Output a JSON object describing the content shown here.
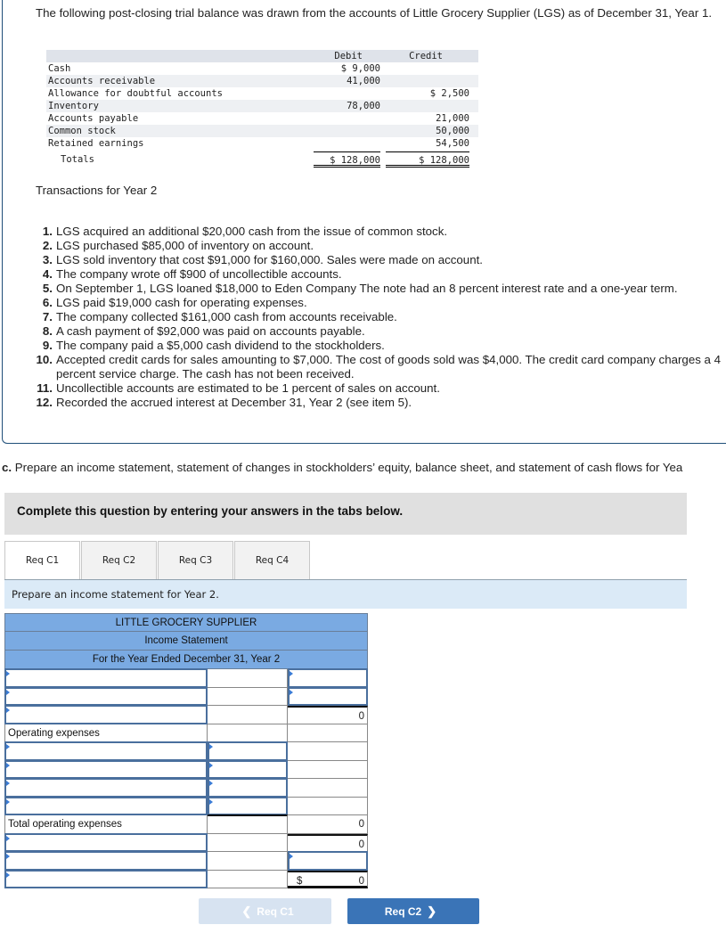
{
  "intro": "The following post-closing trial balance was drawn from the accounts of Little Grocery Supplier (LGS) as of December 31, Year 1.",
  "trial_balance": {
    "headers": {
      "debit": "Debit",
      "credit": "Credit"
    },
    "rows": [
      {
        "account": "Cash",
        "debit": "$ 9,000",
        "credit": ""
      },
      {
        "account": "Accounts receivable",
        "debit": "41,000",
        "credit": ""
      },
      {
        "account": "Allowance for doubtful accounts",
        "debit": "",
        "credit": "$ 2,500"
      },
      {
        "account": "Inventory",
        "debit": "78,000",
        "credit": ""
      },
      {
        "account": "Accounts payable",
        "debit": "",
        "credit": "21,000"
      },
      {
        "account": "Common stock",
        "debit": "",
        "credit": "50,000"
      },
      {
        "account": "Retained earnings",
        "debit": "",
        "credit": "54,500"
      }
    ],
    "totals": {
      "label": "Totals",
      "debit": "$ 128,000",
      "credit": "$ 128,000"
    }
  },
  "transactions": {
    "title": "Transactions for Year 2",
    "items": [
      {
        "num": "1.",
        "text": "LGS acquired an additional $20,000 cash from the issue of common stock."
      },
      {
        "num": "2.",
        "text": "LGS purchased $85,000 of inventory on account."
      },
      {
        "num": "3.",
        "text": "LGS sold inventory that cost $91,000 for $160,000. Sales were made on account."
      },
      {
        "num": "4.",
        "text": "The company wrote off $900 of uncollectible accounts."
      },
      {
        "num": "5.",
        "text": "On September 1, LGS loaned $18,000 to Eden Company The note had an 8 percent interest rate and a one-year term."
      },
      {
        "num": "6.",
        "text": "LGS paid $19,000 cash for operating expenses."
      },
      {
        "num": "7.",
        "text": "The company collected $161,000 cash from accounts receivable."
      },
      {
        "num": "8.",
        "text": "A cash payment of $92,000 was paid on accounts payable."
      },
      {
        "num": "9.",
        "text": "The company paid a $5,000 cash dividend to the stockholders."
      },
      {
        "num": "10.",
        "text": "Accepted credit cards for sales amounting to $7,000. The cost of goods sold was $4,000. The credit card company charges a 4 percent service charge. The cash has not been received."
      },
      {
        "num": "11.",
        "text": "Uncollectible accounts are estimated to be 1 percent of sales on account."
      },
      {
        "num": "12.",
        "text": "Recorded the accrued interest at December 31, Year 2 (see item 5)."
      }
    ]
  },
  "part_c": {
    "label": "c.",
    "text": " Prepare an income statement, statement of changes in stockholders’ equity, balance sheet, and statement of cash flows for Yea"
  },
  "instruction": "Complete this question by entering your answers in the tabs below.",
  "tabs": [
    {
      "label": "Req C1",
      "active": true
    },
    {
      "label": "Req C2",
      "active": false
    },
    {
      "label": "Req C3",
      "active": false
    },
    {
      "label": "Req C4",
      "active": false
    }
  ],
  "prompt": "Prepare an income statement for Year 2.",
  "statement": {
    "company": "LITTLE GROCERY SUPPLIER",
    "title": "Income Statement",
    "period": "For the Year Ended December 31, Year 2",
    "operating_expenses_label": "Operating expenses",
    "total_operating_expenses_label": "Total operating expenses",
    "values": {
      "gross_margin": "0",
      "total_operating_expenses": "0",
      "operating_income": "0",
      "net_income_symbol": "$",
      "net_income": "0"
    }
  },
  "nav": {
    "prev": "Req C1",
    "next": "Req C2"
  }
}
